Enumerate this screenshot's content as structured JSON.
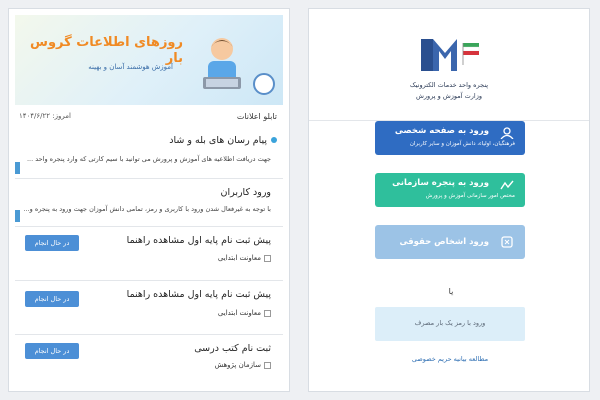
{
  "banner": {
    "title": "روزهای اطلاعات گروس بار",
    "subtitle": "آموزش هوشمند آسان و بهینه"
  },
  "board": {
    "title": "تابلو اعلانات",
    "date": "امروز: ۱۴۰۴/۶/۲۲"
  },
  "notices": [
    {
      "title": "پیام رسان های بله و شاد",
      "text": "جهت دریافت اطلاعیه های آموزش و پرورش می توانید با سیم کارتی که وارد پنجره واحد ..."
    },
    {
      "title": "ورود کاربران",
      "text": "با توجه به غیرفعال شدن ورود با کاربری و رمز، تمامی دانش آموزان جهت ورود به پنجره و..."
    },
    {
      "title": "پیش ثبت نام پایه اول مشاهده راهنما",
      "status": "در حال انجام",
      "sub": "معاونت ابتدایی"
    },
    {
      "title": "پیش ثبت نام پایه اول مشاهده راهنما",
      "status": "در حال انجام",
      "sub": "معاونت ابتدایی"
    },
    {
      "title": "ثبت نام کتب درسی",
      "status": "در حال انجام",
      "sub": "سازمان پژوهش"
    }
  ],
  "org": {
    "line1": "پنجره واحد خدمات الکترونیک",
    "line2": "وزارت آموزش و پرورش"
  },
  "login": {
    "personal": {
      "title": "ورود به صفحه شخصی",
      "sub": "فرهنگیان، اولیاء، دانش آموزان و سایر کاربران",
      "icon": "user-icon",
      "color": "#2f6cc2"
    },
    "org": {
      "title": "ورود به پنجره سازمانی",
      "sub": "مختص امور سازمانی آموزش و پرورش",
      "icon": "org-icon",
      "color": "#2fbf9c"
    },
    "legal": {
      "title": "ورود اشخاص حقوقی",
      "icon": "building-icon",
      "color": "#9cc3e6"
    }
  },
  "or_text": "یا",
  "otp_text": "ورود با رمز یک بار مصرف",
  "privacy_text": "مطالعه بیانیه حریم خصوصی"
}
